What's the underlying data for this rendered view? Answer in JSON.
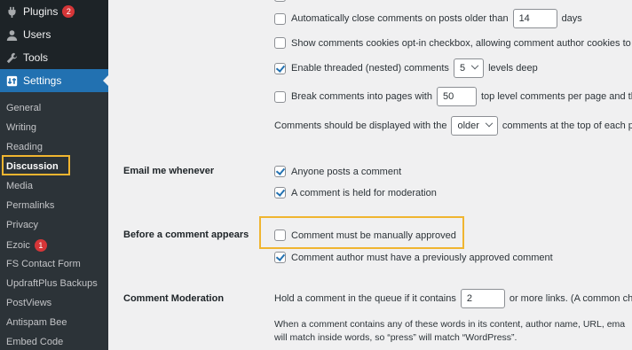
{
  "sidebar": {
    "top_items": [
      {
        "label": "Plugins",
        "icon": "plugin-icon",
        "badge": "2"
      },
      {
        "label": "Users",
        "icon": "users-icon"
      },
      {
        "label": "Tools",
        "icon": "wrench-icon"
      },
      {
        "label": "Settings",
        "icon": "settings-icon"
      }
    ],
    "sub_items": [
      {
        "label": "General"
      },
      {
        "label": "Writing"
      },
      {
        "label": "Reading"
      },
      {
        "label": "Discussion"
      },
      {
        "label": "Media"
      },
      {
        "label": "Permalinks"
      },
      {
        "label": "Privacy"
      },
      {
        "label": "Ezoic",
        "badge": "1"
      },
      {
        "label": "FS Contact Form"
      },
      {
        "label": "UpdraftPlus Backups"
      },
      {
        "label": "PostViews"
      },
      {
        "label": "Antispam Bee"
      },
      {
        "label": "Embed Code"
      }
    ]
  },
  "other_settings": {
    "auto_close": {
      "before": "Automatically close comments on posts older than",
      "value": "14",
      "after": "days",
      "checked": false
    },
    "cookies_optin": {
      "label": "Show comments cookies opt-in checkbox, allowing comment author cookies to be",
      "checked": false
    },
    "threaded": {
      "before": "Enable threaded (nested) comments",
      "value": "5",
      "after": "levels deep",
      "checked": true
    },
    "break_pages": {
      "before": "Break comments into pages with",
      "value": "50",
      "after": "top level comments per page and th",
      "checked": false
    },
    "display_order": {
      "before": "Comments should be displayed with the",
      "value": "older",
      "after": "comments at the top of each pa"
    }
  },
  "email_me": {
    "heading": "Email me whenever",
    "anyone_posts": {
      "label": "Anyone posts a comment",
      "checked": true
    },
    "held_moderation": {
      "label": "A comment is held for moderation",
      "checked": true
    }
  },
  "before_appears": {
    "heading": "Before a comment appears",
    "manual_approve": {
      "label": "Comment must be manually approved",
      "checked": false
    },
    "prev_approved": {
      "label": "Comment author must have a previously approved comment",
      "checked": true
    }
  },
  "moderation": {
    "heading": "Comment Moderation",
    "before": "Hold a comment in the queue if it contains",
    "value": "2",
    "after": "or more links. (A common cha",
    "desc_line1": "When a comment contains any of these words in its content, author name, URL, ema",
    "desc_line2": "will match inside words, so “press” will match “WordPress”."
  },
  "colors": {
    "sidebar_bg": "#1d2327",
    "accent": "#2271b1",
    "highlight": "#f0b530",
    "badge": "#d63638"
  }
}
